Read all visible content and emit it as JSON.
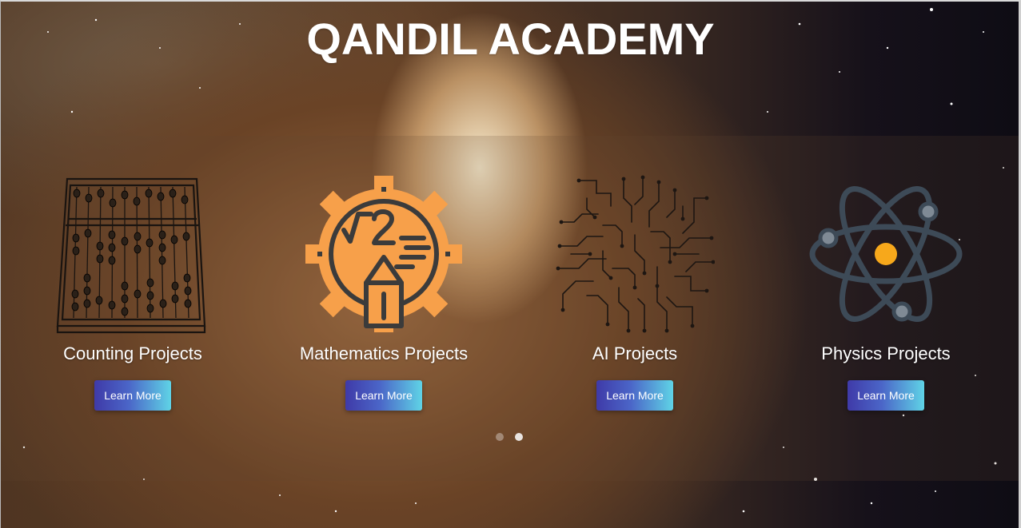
{
  "site": {
    "title": "QANDIL ACADEMY"
  },
  "carousel": {
    "cards": [
      {
        "label": "Counting Projects",
        "button": "Learn More",
        "icon": "abacus-icon"
      },
      {
        "label": "Mathematics Projects",
        "button": "Learn More",
        "icon": "math-gear-icon"
      },
      {
        "label": "AI Projects",
        "button": "Learn More",
        "icon": "circuit-brain-icon"
      },
      {
        "label": "Physics Projects",
        "button": "Learn More",
        "icon": "atom-icon"
      }
    ],
    "indicators": {
      "count": 2,
      "active": 1
    }
  },
  "colors": {
    "button_gradient_start": "#3f3aa8",
    "button_gradient_end": "#5fd3e6",
    "math_accent": "#f7a04a",
    "atom_stroke": "#3d4a57",
    "atom_nucleus": "#f7a81b"
  }
}
